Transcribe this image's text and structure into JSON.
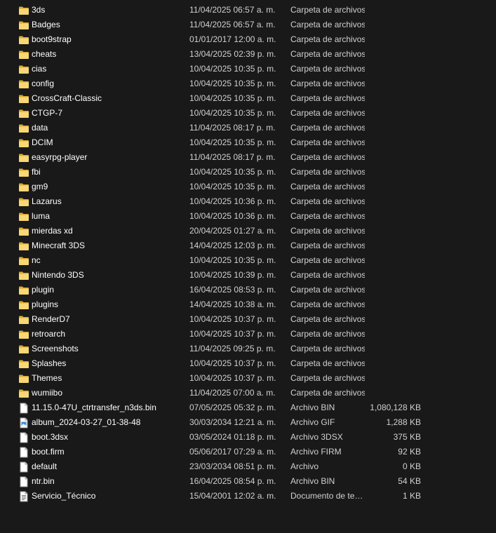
{
  "files": [
    {
      "name": "3ds",
      "date": "11/04/2025 06:57 a. m.",
      "type": "Carpeta de archivos",
      "size": "",
      "icon": "folder-icon"
    },
    {
      "name": "Badges",
      "date": "11/04/2025 06:57 a. m.",
      "type": "Carpeta de archivos",
      "size": "",
      "icon": "folder-icon"
    },
    {
      "name": "boot9strap",
      "date": "01/01/2017 12:00 a. m.",
      "type": "Carpeta de archivos",
      "size": "",
      "icon": "folder-icon"
    },
    {
      "name": "cheats",
      "date": "13/04/2025 02:39 p. m.",
      "type": "Carpeta de archivos",
      "size": "",
      "icon": "folder-icon"
    },
    {
      "name": "cias",
      "date": "10/04/2025 10:35 p. m.",
      "type": "Carpeta de archivos",
      "size": "",
      "icon": "folder-icon"
    },
    {
      "name": "config",
      "date": "10/04/2025 10:35 p. m.",
      "type": "Carpeta de archivos",
      "size": "",
      "icon": "folder-icon"
    },
    {
      "name": "CrossCraft-Classic",
      "date": "10/04/2025 10:35 p. m.",
      "type": "Carpeta de archivos",
      "size": "",
      "icon": "folder-icon"
    },
    {
      "name": "CTGP-7",
      "date": "10/04/2025 10:35 p. m.",
      "type": "Carpeta de archivos",
      "size": "",
      "icon": "folder-icon"
    },
    {
      "name": "data",
      "date": "11/04/2025 08:17 p. m.",
      "type": "Carpeta de archivos",
      "size": "",
      "icon": "folder-icon"
    },
    {
      "name": "DCIM",
      "date": "10/04/2025 10:35 p. m.",
      "type": "Carpeta de archivos",
      "size": "",
      "icon": "folder-icon"
    },
    {
      "name": "easyrpg-player",
      "date": "11/04/2025 08:17 p. m.",
      "type": "Carpeta de archivos",
      "size": "",
      "icon": "folder-icon"
    },
    {
      "name": "fbi",
      "date": "10/04/2025 10:35 p. m.",
      "type": "Carpeta de archivos",
      "size": "",
      "icon": "folder-icon"
    },
    {
      "name": "gm9",
      "date": "10/04/2025 10:35 p. m.",
      "type": "Carpeta de archivos",
      "size": "",
      "icon": "folder-icon"
    },
    {
      "name": "Lazarus",
      "date": "10/04/2025 10:36 p. m.",
      "type": "Carpeta de archivos",
      "size": "",
      "icon": "folder-icon"
    },
    {
      "name": "luma",
      "date": "10/04/2025 10:36 p. m.",
      "type": "Carpeta de archivos",
      "size": "",
      "icon": "folder-icon"
    },
    {
      "name": "mierdas xd",
      "date": "20/04/2025 01:27 a. m.",
      "type": "Carpeta de archivos",
      "size": "",
      "icon": "folder-icon"
    },
    {
      "name": "Minecraft 3DS",
      "date": "14/04/2025 12:03 p. m.",
      "type": "Carpeta de archivos",
      "size": "",
      "icon": "folder-icon"
    },
    {
      "name": "nc",
      "date": "10/04/2025 10:35 p. m.",
      "type": "Carpeta de archivos",
      "size": "",
      "icon": "folder-icon"
    },
    {
      "name": "Nintendo 3DS",
      "date": "10/04/2025 10:39 p. m.",
      "type": "Carpeta de archivos",
      "size": "",
      "icon": "folder-icon"
    },
    {
      "name": "plugin",
      "date": "16/04/2025 08:53 p. m.",
      "type": "Carpeta de archivos",
      "size": "",
      "icon": "folder-icon"
    },
    {
      "name": "plugins",
      "date": "14/04/2025 10:38 a. m.",
      "type": "Carpeta de archivos",
      "size": "",
      "icon": "folder-icon"
    },
    {
      "name": "RenderD7",
      "date": "10/04/2025 10:37 p. m.",
      "type": "Carpeta de archivos",
      "size": "",
      "icon": "folder-icon"
    },
    {
      "name": "retroarch",
      "date": "10/04/2025 10:37 p. m.",
      "type": "Carpeta de archivos",
      "size": "",
      "icon": "folder-icon"
    },
    {
      "name": "Screenshots",
      "date": "11/04/2025 09:25 p. m.",
      "type": "Carpeta de archivos",
      "size": "",
      "icon": "folder-icon"
    },
    {
      "name": "Splashes",
      "date": "10/04/2025 10:37 p. m.",
      "type": "Carpeta de archivos",
      "size": "",
      "icon": "folder-icon"
    },
    {
      "name": "Themes",
      "date": "10/04/2025 10:37 p. m.",
      "type": "Carpeta de archivos",
      "size": "",
      "icon": "folder-icon"
    },
    {
      "name": "wumiibo",
      "date": "11/04/2025 07:00 a. m.",
      "type": "Carpeta de archivos",
      "size": "",
      "icon": "folder-icon"
    },
    {
      "name": "11.15.0-47U_ctrtransfer_n3ds.bin",
      "date": "07/05/2025 05:32 p. m.",
      "type": "Archivo BIN",
      "size": "1,080,128 KB",
      "icon": "file-icon"
    },
    {
      "name": "album_2024-03-27_01-38-48",
      "date": "30/03/2034 12:21 a. m.",
      "type": "Archivo GIF",
      "size": "1,288 KB",
      "icon": "image-file-icon"
    },
    {
      "name": "boot.3dsx",
      "date": "03/05/2024 01:18 p. m.",
      "type": "Archivo 3DSX",
      "size": "375 KB",
      "icon": "file-icon"
    },
    {
      "name": "boot.firm",
      "date": "05/06/2017 07:29 a. m.",
      "type": "Archivo FIRM",
      "size": "92 KB",
      "icon": "file-icon"
    },
    {
      "name": "default",
      "date": "23/03/2034 08:51 p. m.",
      "type": "Archivo",
      "size": "0 KB",
      "icon": "file-icon"
    },
    {
      "name": "ntr.bin",
      "date": "16/04/2025 08:54 p. m.",
      "type": "Archivo BIN",
      "size": "54 KB",
      "icon": "file-icon"
    },
    {
      "name": "Servicio_Técnico",
      "date": "15/04/2001 12:02 a. m.",
      "type": "Documento de te…",
      "size": "1 KB",
      "icon": "text-document-icon"
    }
  ]
}
